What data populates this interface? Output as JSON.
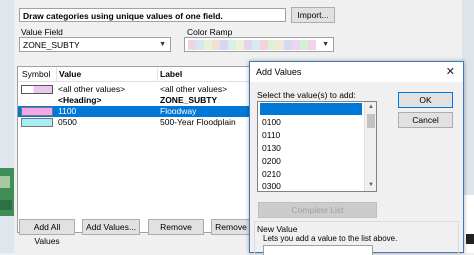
{
  "panel": {
    "description": "Draw categories using unique values of one field.",
    "import_label": "Import...",
    "value_field_label": "Value Field",
    "value_field_value": "ZONE_SUBTY",
    "color_ramp_label": "Color Ramp",
    "color_ramp_colors": [
      "#f1d3e8",
      "#d4e8f1",
      "#e8f1d3",
      "#f1e0d4",
      "#d8d4f1",
      "#d4f1e4",
      "#f1f0d4",
      "#e2d4f1",
      "#d4ecf1",
      "#f1d4d9",
      "#dff1d4",
      "#f1e9d4",
      "#d4d9f1",
      "#eed4f1",
      "#d4f1d6",
      "#f1d4e5"
    ],
    "table": {
      "headers": {
        "symbol": "Symbol",
        "value": "Value",
        "label": "Label"
      },
      "rows": [
        {
          "value": "<all other values>",
          "label": "<all other values>",
          "symbol_color": "#ffffff",
          "symbol_color2": "#e8c8ee",
          "selected": false,
          "bold": false
        },
        {
          "value": "<Heading>",
          "label": "ZONE_SUBTY",
          "symbol_color": "",
          "symbol_color2": "",
          "selected": false,
          "bold": true
        },
        {
          "value": "1100",
          "label": "Floodway",
          "symbol_color": "#f3a6ea",
          "symbol_color2": "",
          "selected": true,
          "bold": false
        },
        {
          "value": "0500",
          "label": "500-Year Floodplain",
          "symbol_color": "#a9ecf5",
          "symbol_color2": "",
          "selected": false,
          "bold": false
        }
      ]
    },
    "buttons": {
      "add_all": "Add All Values",
      "add_values": "Add Values...",
      "remove": "Remove",
      "remove2": "Remove"
    }
  },
  "dialog": {
    "title": "Add Values",
    "select_label": "Select the value(s) to add:",
    "values": [
      "",
      "0100",
      "0110",
      "0130",
      "0200",
      "0210",
      "0300"
    ],
    "ok_label": "OK",
    "cancel_label": "Cancel",
    "complete_list_label": "Complete List",
    "new_value_title": "New Value",
    "new_value_help": "Lets you add a value to the list above."
  }
}
